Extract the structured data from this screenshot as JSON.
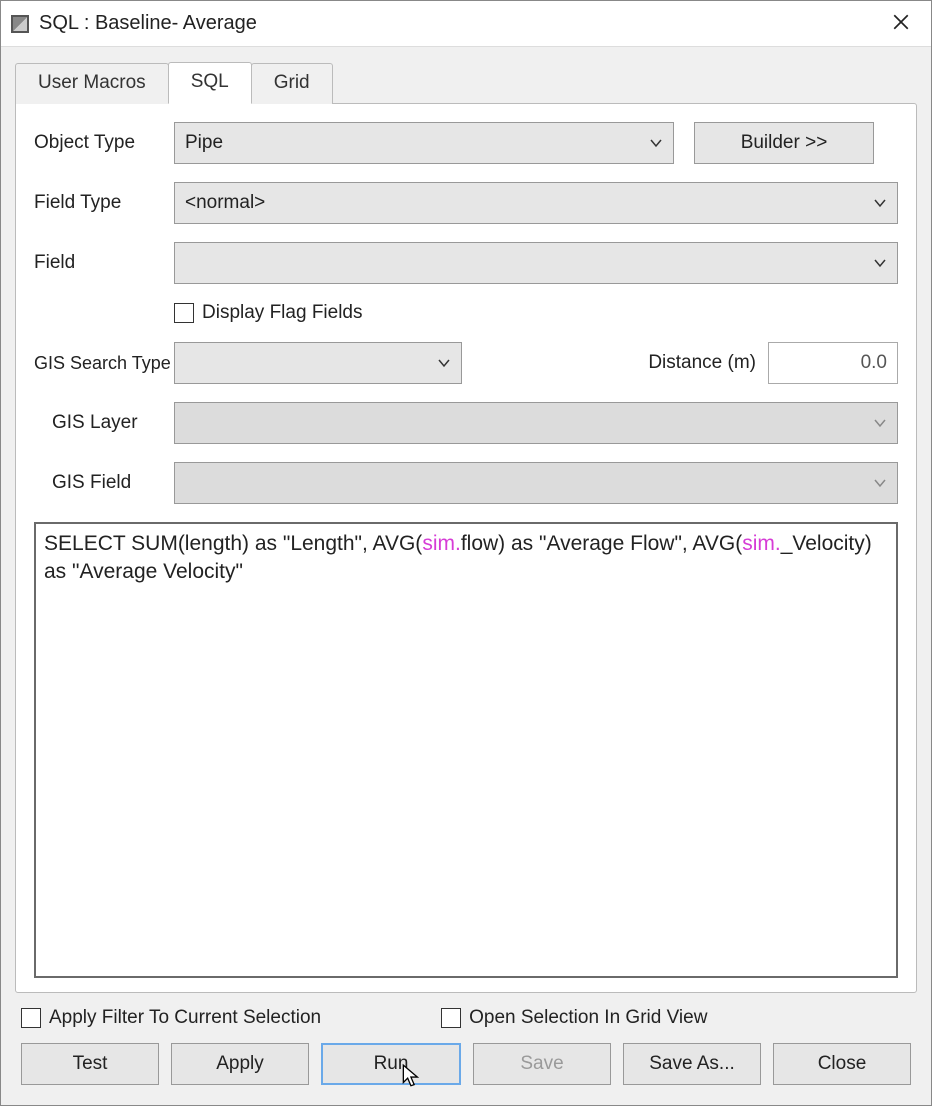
{
  "window": {
    "title": "SQL : Baseline- Average"
  },
  "tabs": {
    "user_macros": "User Macros",
    "sql": "SQL",
    "grid": "Grid",
    "active": "SQL"
  },
  "labels": {
    "object_type": "Object Type",
    "field_type": "Field Type",
    "field": "Field",
    "display_flag_fields": "Display Flag Fields",
    "gis_search_type": "GIS Search Type",
    "distance": "Distance (m)",
    "gis_layer": "GIS Layer",
    "gis_field": "GIS Field",
    "apply_filter": "Apply Filter To Current Selection",
    "open_selection": "Open Selection In Grid View"
  },
  "values": {
    "object_type": "Pipe",
    "field_type": "<normal>",
    "field": "",
    "gis_search_type": "",
    "distance": "0.0",
    "gis_layer": "",
    "gis_field": ""
  },
  "buttons": {
    "builder": "Builder >>",
    "test": "Test",
    "apply": "Apply",
    "run": "Run",
    "save": "Save",
    "save_as": "Save As...",
    "close": "Close"
  },
  "sql": {
    "pre1": "SELECT SUM(length) as \"Length\", AVG(",
    "sim1": "sim.",
    "mid1": "flow) as \"Average Flow\", AVG(",
    "sim2": "sim.",
    "post1": "_Velocity) as \"Average Velocity\""
  }
}
